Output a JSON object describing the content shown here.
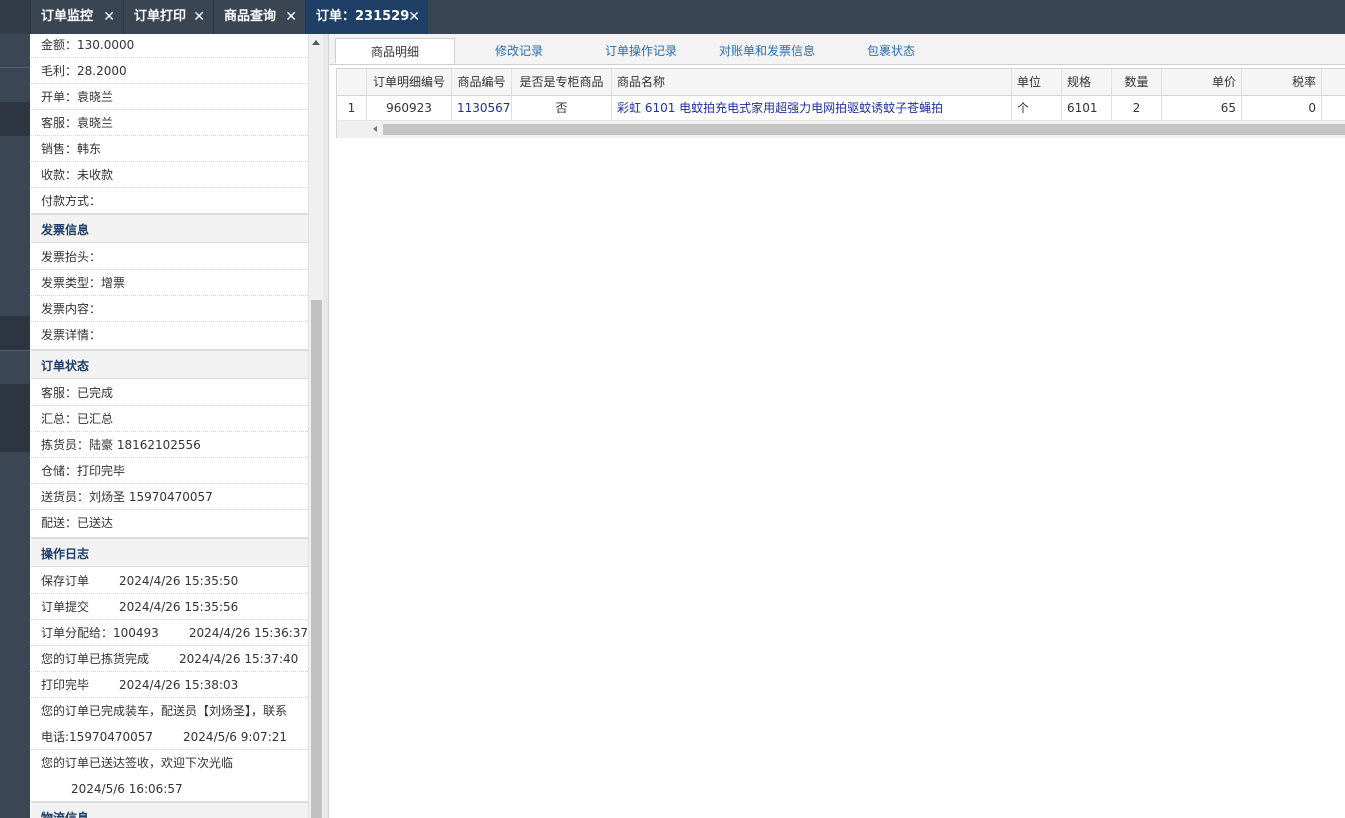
{
  "tabs": [
    {
      "label": "订单监控",
      "close": "✕"
    },
    {
      "label": "订单打印",
      "close": "✕"
    },
    {
      "label": "商品查询",
      "close": "✕"
    },
    {
      "label": "订单：231529",
      "close": "✕"
    }
  ],
  "order_info": [
    "金额：130.0000",
    "毛利：28.2000",
    "开单：袁晓兰",
    "客服：袁晓兰",
    "销售：韩东",
    "收款：未收款",
    "付款方式："
  ],
  "invoice_section": {
    "title": "发票信息",
    "rows": [
      "发票抬头：",
      "发票类型：增票",
      "发票内容：",
      "发票详情："
    ]
  },
  "status_section": {
    "title": "订单状态",
    "rows": [
      "客服：已完成",
      "汇总：已汇总",
      "拣货员：陆豪 18162102556",
      "仓储：打印完毕",
      "送货员：刘炀圣 15970470057",
      "配送：已送达"
    ]
  },
  "log_section": {
    "title": "操作日志",
    "entries": [
      {
        "text": "保存订单",
        "time": "2024/4/26 15:35:50"
      },
      {
        "text": "订单提交",
        "time": "2024/4/26 15:35:56"
      },
      {
        "text": "订单分配给：100493",
        "time": "2024/4/26 15:36:37"
      },
      {
        "text": "您的订单已拣货完成",
        "time": "2024/4/26 15:37:40"
      },
      {
        "text": "打印完毕",
        "time": "2024/4/26 15:38:03"
      },
      {
        "text": "您的订单已完成装车，配送员【刘炀圣】，联系",
        "text2": "电话:15970470057",
        "time": "2024/5/6 9:07:21"
      },
      {
        "text": "您的订单已送达签收，欢迎下次光临",
        "time": "2024/5/6 16:06:57"
      }
    ]
  },
  "logistics_section": {
    "title": "物流信息"
  },
  "content_tabs": [
    "商品明细",
    "修改记录",
    "订单操作记录",
    "对账单和发票信息",
    "包裹状态"
  ],
  "grid": {
    "columns": [
      "",
      "订单明细编号",
      "商品编号",
      "是否是专柜商品",
      "商品名称",
      "单位",
      "规格",
      "数量",
      "单价",
      "税率"
    ],
    "rows": [
      [
        "1",
        "960923",
        "1130567",
        "否",
        "彩虹 6101 电蚊拍充电式家用超强力电网拍驱蚊诱蚊子苍蝇拍",
        "个",
        "6101",
        "2",
        "65",
        "0"
      ]
    ]
  },
  "colors": {
    "topbar": "#3a4553",
    "active_tab": "#1f3f67",
    "section_title": "#1f3f67",
    "link": "#1f2fa0"
  }
}
